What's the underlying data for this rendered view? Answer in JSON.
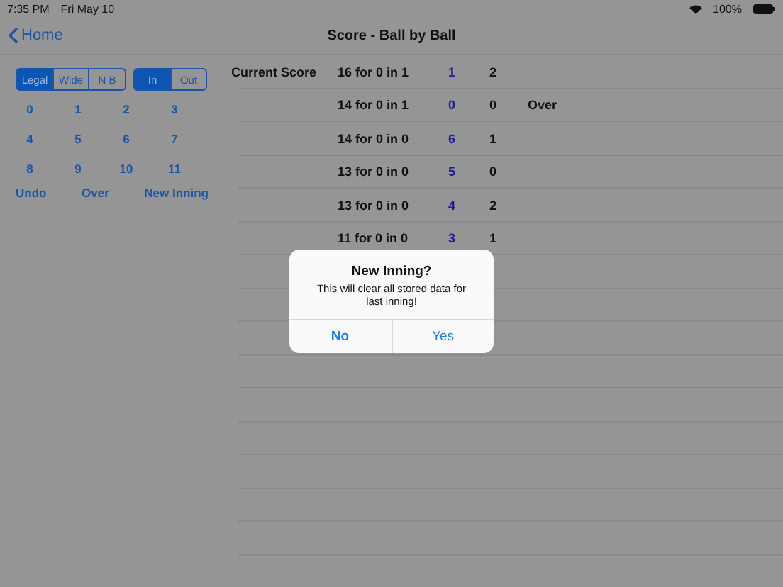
{
  "status_bar": {
    "time": "7:35 PM",
    "date": "Fri May 10",
    "battery": "100%"
  },
  "nav": {
    "back": "Home",
    "title": "Score - Ball by Ball"
  },
  "ball_type": [
    {
      "label": "Legal",
      "selected": true
    },
    {
      "label": "Wide",
      "selected": false
    },
    {
      "label": "N B",
      "selected": false
    }
  ],
  "in_out": [
    {
      "label": "In",
      "selected": true
    },
    {
      "label": "Out",
      "selected": false
    }
  ],
  "run_keys": [
    "0",
    "1",
    "2",
    "3",
    "4",
    "5",
    "6",
    "7",
    "8",
    "9",
    "10",
    "11"
  ],
  "actions": [
    "Undo",
    "Over",
    "New Inning"
  ],
  "score_rows": [
    {
      "label": "Current Score",
      "score": "16 for 0 in 1",
      "runs": "1",
      "column_4": "2"
    },
    {
      "score": "14 for 0 in 1",
      "runs": "0",
      "column_4": "0",
      "note": "Over"
    },
    {
      "score": "14 for 0 in 0",
      "runs": "6",
      "column_4": "1"
    },
    {
      "score": "13 for 0 in 0",
      "runs": "5",
      "column_4": "0"
    },
    {
      "score": "13 for 0 in 0",
      "runs": "4",
      "column_4": "2"
    },
    {
      "score": "11 for 0 in 0",
      "runs": "3",
      "column_4": "1"
    }
  ],
  "dialog": {
    "title": "New Inning?",
    "message": "This will clear all stored data for last inning!",
    "buttons": [
      {
        "label": "No",
        "kind": "cancel"
      },
      {
        "label": "Yes",
        "kind": "default"
      }
    ]
  }
}
